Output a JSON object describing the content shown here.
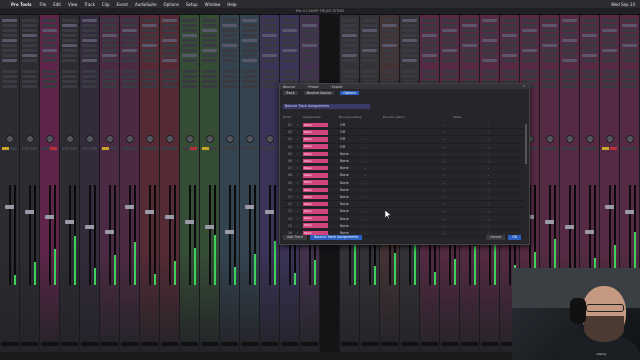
{
  "menubar": {
    "apple": "",
    "app_name": "Pro Tools",
    "items": [
      "File",
      "Edit",
      "View",
      "Track",
      "Clip",
      "Event",
      "AudioSuite",
      "Options",
      "Setup",
      "Window",
      "Help"
    ],
    "status": "Wed Sep 14"
  },
  "window_title": "Mix 01 BUMP TRUCK STEMS",
  "dialog": {
    "label_left": "Bounce",
    "label_mid": "Preset",
    "label_right": "Export",
    "close": "×",
    "sub": [
      "Track",
      "Bounce Source",
      "Options"
    ],
    "banner": "Bounce Track Assignments",
    "columns": [
      "Order",
      "Assignment",
      "Bounce setting",
      "Bounce option",
      "Mode"
    ],
    "rows": [
      {
        "num": "01",
        "assign": "Stem",
        "bounce": "Off"
      },
      {
        "num": "02",
        "assign": "Stem",
        "bounce": "Off"
      },
      {
        "num": "03",
        "assign": "Stem",
        "bounce": "Off"
      },
      {
        "num": "04",
        "assign": "Stem",
        "bounce": "Off"
      },
      {
        "num": "05",
        "assign": "Stem",
        "bounce": "None"
      },
      {
        "num": "06",
        "assign": "Stem",
        "bounce": "None"
      },
      {
        "num": "07",
        "assign": "Stem",
        "bounce": "None"
      },
      {
        "num": "08",
        "assign": "Stem",
        "bounce": "None"
      },
      {
        "num": "09",
        "assign": "Stem",
        "bounce": "None"
      },
      {
        "num": "10",
        "assign": "Stem",
        "bounce": "None"
      },
      {
        "num": "11",
        "assign": "Stem",
        "bounce": "None"
      },
      {
        "num": "12",
        "assign": "Stem",
        "bounce": "None"
      },
      {
        "num": "13",
        "assign": "Stem",
        "bounce": "None"
      },
      {
        "num": "14",
        "assign": "Stem",
        "bounce": "None"
      },
      {
        "num": "15",
        "assign": "Stem",
        "bounce": "None"
      },
      {
        "num": "16",
        "assign": "Stem",
        "bounce": "None"
      }
    ],
    "footer": {
      "left": "Add Track",
      "primary": "Bounce Track Assignments",
      "cancel": "Cancel",
      "ok": "OK"
    }
  },
  "colors": {
    "assign": "#d1447d",
    "accent": "#2b5fbf",
    "meter": "#3bd15a"
  },
  "webcam": {
    "tag": "udemy"
  }
}
